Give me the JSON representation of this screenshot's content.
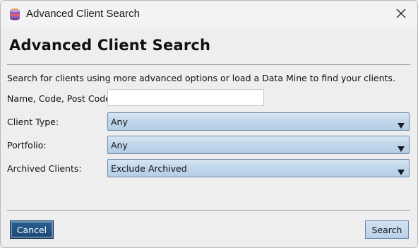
{
  "window": {
    "title": "Advanced Client Search",
    "icons": {
      "app": "app-logo-icon",
      "close": "close-icon"
    }
  },
  "main": {
    "heading": "Advanced Client Search",
    "description": "Search for clients using more advanced options or load a Data Mine to find your clients.",
    "name_search": {
      "label": "Name, Code, Post Code",
      "value": "",
      "placeholder": ""
    },
    "client_type": {
      "label": "Client Type:",
      "selected": "Any"
    },
    "portfolio": {
      "label": "Portfolio:",
      "selected": "Any"
    },
    "archived": {
      "label": "Archived Clients:",
      "selected": "Exclude Archived"
    }
  },
  "footer": {
    "cancel_label": "Cancel",
    "search_label": "Search"
  },
  "colors": {
    "combo_fill": "#c2d7ec",
    "combo_border": "#6d87a8",
    "primary_button": "#1c4a78"
  }
}
